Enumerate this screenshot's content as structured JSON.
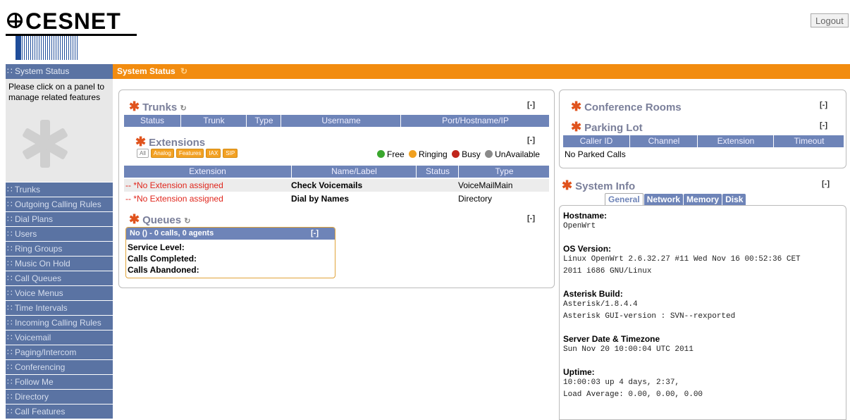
{
  "brand": {
    "name": "CESNET"
  },
  "header": {
    "logout_label": "Logout"
  },
  "topbar": {
    "title": "System Status",
    "icon": "refresh-icon"
  },
  "sidebar": {
    "current": "System Status",
    "info": "Please click on a panel to manage related features",
    "items": [
      {
        "label": "Trunks"
      },
      {
        "label": "Outgoing Calling Rules"
      },
      {
        "label": "Dial Plans"
      },
      {
        "label": "Users"
      },
      {
        "label": "Ring Groups"
      },
      {
        "label": "Music On Hold"
      },
      {
        "label": "Call Queues"
      },
      {
        "label": "Voice Menus"
      },
      {
        "label": "Time Intervals"
      },
      {
        "label": "Incoming Calling Rules"
      },
      {
        "label": "Voicemail"
      },
      {
        "label": "Paging/Intercom"
      },
      {
        "label": "Conferencing"
      },
      {
        "label": "Follow Me"
      },
      {
        "label": "Directory"
      },
      {
        "label": "Call Features"
      }
    ]
  },
  "trunks": {
    "title": "Trunks",
    "toggle": "[-]",
    "columns": [
      "Status",
      "Trunk",
      "Type",
      "Username",
      "Port/Hostname/IP"
    ]
  },
  "extensions": {
    "title": "Extensions",
    "toggle": "[-]",
    "filters": [
      "All",
      "Analog",
      "Features",
      "IAX",
      "SIP"
    ],
    "legend": [
      {
        "label": "Free",
        "color": "#3aa72e"
      },
      {
        "label": "Ringing",
        "color": "#f0a020"
      },
      {
        "label": "Busy",
        "color": "#c0261c"
      },
      {
        "label": "UnAvailable",
        "color": "#8a8a8a"
      }
    ],
    "columns": [
      "Extension",
      "Name/Label",
      "Status",
      "Type"
    ],
    "rows": [
      {
        "extension": "-- *No Extension assigned",
        "name": "Check Voicemails",
        "status": "",
        "type": "VoiceMailMain"
      },
      {
        "extension": "-- *No Extension assigned",
        "name": "Dial by Names",
        "status": "",
        "type": "Directory"
      }
    ]
  },
  "queues": {
    "title": "Queues",
    "toggle": "[-]",
    "queue_header": "No () - 0 calls, 0 agents",
    "queue_toggle": "[-]",
    "service_level": "Service Level:",
    "calls_completed": "Calls Completed:",
    "calls_abandoned": "Calls Abandoned:"
  },
  "conference": {
    "title": "Conference Rooms",
    "toggle": "[-]"
  },
  "parking": {
    "title": "Parking Lot",
    "toggle": "[-]",
    "columns": [
      "Caller ID",
      "Channel",
      "Extension",
      "Timeout"
    ],
    "empty": "No Parked Calls"
  },
  "system_info": {
    "title": "System Info",
    "toggle": "[-]",
    "tabs": [
      "General",
      "Network",
      "Memory",
      "Disk"
    ],
    "active_tab": "General",
    "hostname_label": "Hostname:",
    "hostname": "OpenWrt",
    "os_label": "OS Version:",
    "os_line1": "Linux OpenWrt 2.6.32.27 #11 Wed Nov 16 00:52:36 CET",
    "os_line2": "2011 i686 GNU/Linux",
    "asterisk_label": "Asterisk Build:",
    "asterisk_line1": "Asterisk/1.8.4.4",
    "asterisk_line2": "Asterisk GUI-version : SVN--rexported",
    "date_label": "Server Date & Timezone",
    "date": "Sun Nov 20 10:00:04 UTC 2011",
    "uptime_label": "Uptime:",
    "uptime_line1": "10:00:03 up 4 days, 2:37,",
    "uptime_line2": "Load Average: 0.00, 0.00, 0.00"
  }
}
